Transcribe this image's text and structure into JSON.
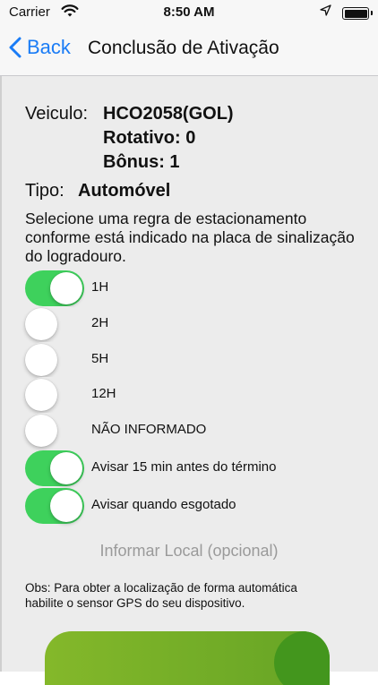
{
  "status_bar": {
    "carrier": "Carrier",
    "time": "8:50 AM"
  },
  "nav": {
    "back_label": "Back",
    "title": "Conclusão de Ativação"
  },
  "vehicle": {
    "label": "Veiculo:",
    "plate": "HCO2058(GOL)",
    "rotativo": "Rotativo: 0",
    "bonus": "Bônus: 1"
  },
  "tipo": {
    "label": "Tipo:",
    "value": "Automóvel"
  },
  "instruction": "Selecione uma regra de estacionamento conforme está indicado na placa de sinalização do logradouro.",
  "rules": [
    {
      "label": "1H",
      "on": true
    },
    {
      "label": "2H",
      "on": false
    },
    {
      "label": "5H",
      "on": false
    },
    {
      "label": "12H",
      "on": false
    },
    {
      "label": "NÃO INFORMADO",
      "on": false
    }
  ],
  "alerts": [
    {
      "label": "Avisar 15 min antes do término",
      "on": true
    },
    {
      "label": "Avisar quando esgotado",
      "on": true
    }
  ],
  "informar_local": "Informar Local (opcional)",
  "obs": "Obs: Para obter a localização de forma automática habilite o sensor GPS do seu dispositivo.",
  "colors": {
    "accent": "#1a7cf6",
    "toggle_on": "#3ed15c",
    "button_green": "#6aa726"
  }
}
